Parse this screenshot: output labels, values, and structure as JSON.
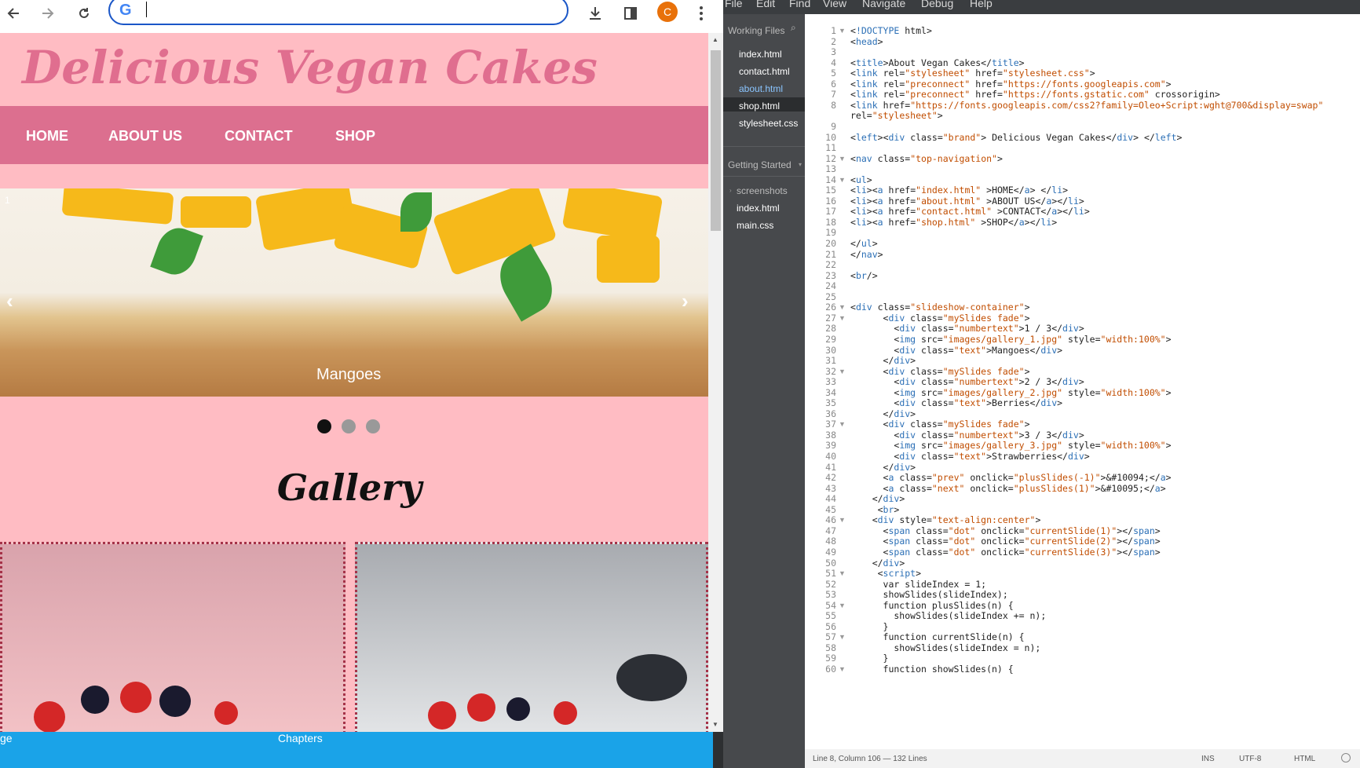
{
  "browser": {
    "google_glyph": "G",
    "profile_initial": "C",
    "icons": [
      "back-arrow-icon",
      "forward-arrow-icon",
      "reload-icon",
      "download-icon",
      "side-panel-icon",
      "more-vert-icon"
    ]
  },
  "site": {
    "brand": "Delicious Vegan Cakes",
    "nav": [
      "HOME",
      "ABOUT US",
      "CONTACT",
      "SHOP"
    ],
    "slide_caption": "Mangoes",
    "prev_arrow": "‹",
    "next_arrow": "›",
    "slide_counter": "1",
    "gallery_title": "Gallery",
    "colors": {
      "background": "#ffbcc3",
      "nav": "#dc6f8f",
      "brand": "#e06e8f"
    }
  },
  "taskbar": {
    "left_fragment": "ge",
    "chapters": "Chapters"
  },
  "editor": {
    "menu": [
      "File",
      "Edit",
      "Find",
      "View",
      "Navigate",
      "Debug",
      "Help"
    ],
    "working_files_label": "Working Files",
    "working_files": [
      "index.html",
      "contact.html",
      "about.html",
      "shop.html",
      "stylesheet.css"
    ],
    "active_file": "about.html",
    "getting_started_label": "Getting Started",
    "project_folder": "screenshots",
    "project_files": [
      "index.html",
      "main.css"
    ],
    "status": {
      "position": "Line 8, Column 106 — 132 Lines",
      "mode": "INS",
      "encoding": "UTF-8",
      "language": "HTML"
    },
    "code_lines": [
      "<!DOCTYPE html>",
      "<head>",
      "",
      "<title>About Vegan Cakes</title>",
      "<link rel=\"stylesheet\" href=\"stylesheet.css\">",
      "<link rel=\"preconnect\" href=\"https://fonts.googleapis.com\">",
      "<link rel=\"preconnect\" href=\"https://fonts.gstatic.com\" crossorigin>",
      "<link href=\"https://fonts.googleapis.com/css2?family=Oleo+Script:wght@700&display=swap\"",
      "rel=\"stylesheet\">",
      "",
      "<left><div class=\"brand\"> Delicious Vegan Cakes</div> </left>",
      "",
      "<nav class=\"top-navigation\">",
      "",
      "<ul>",
      "<li><a href=\"index.html\" >HOME</a> </li>",
      "<li><a href=\"about.html\" >ABOUT US</a></li>",
      "<li><a href=\"contact.html\" >CONTACT</a></li>",
      "<li><a href=\"shop.html\" >SHOP</a></li>",
      "",
      "</ul>",
      "</nav>",
      "",
      "<br/>",
      "",
      "",
      "<div class=\"slideshow-container\">",
      "      <div class=\"mySlides fade\">",
      "        <div class=\"numbertext\">1 / 3</div>",
      "        <img src=\"images/gallery_1.jpg\" style=\"width:100%\">",
      "        <div class=\"text\">Mangoes</div>",
      "      </div>",
      "      <div class=\"mySlides fade\">",
      "        <div class=\"numbertext\">2 / 3</div>",
      "        <img src=\"images/gallery_2.jpg\" style=\"width:100%\">",
      "        <div class=\"text\">Berries</div>",
      "      </div>",
      "      <div class=\"mySlides fade\">",
      "        <div class=\"numbertext\">3 / 3</div>",
      "        <img src=\"images/gallery_3.jpg\" style=\"width:100%\">",
      "        <div class=\"text\">Strawberries</div>",
      "      </div>",
      "      <a class=\"prev\" onclick=\"plusSlides(-1)\">&#10094;</a>",
      "      <a class=\"next\" onclick=\"plusSlides(1)\">&#10095;</a>",
      "    </div>",
      "     <br>",
      "    <div style=\"text-align:center\">",
      "      <span class=\"dot\" onclick=\"currentSlide(1)\"></span>",
      "      <span class=\"dot\" onclick=\"currentSlide(2)\"></span>",
      "      <span class=\"dot\" onclick=\"currentSlide(3)\"></span>",
      "    </div>",
      "     <script>",
      "      var slideIndex = 1;",
      "      showSlides(slideIndex);",
      "      function plusSlides(n) {",
      "        showSlides(slideIndex += n);",
      "      }",
      "      function currentSlide(n) {",
      "        showSlides(slideIndex = n);",
      "      }",
      "      function showSlides(n) {"
    ],
    "line_numbers": [
      "1",
      "2",
      "3",
      "4",
      "5",
      "6",
      "7",
      "8",
      "",
      "9",
      "10",
      "11",
      "12",
      "13",
      "14",
      "15",
      "16",
      "17",
      "18",
      "19",
      "20",
      "21",
      "22",
      "23",
      "24",
      "25",
      "26",
      "27",
      "28",
      "29",
      "30",
      "31",
      "32",
      "33",
      "34",
      "35",
      "36",
      "37",
      "38",
      "39",
      "40",
      "41",
      "42",
      "43",
      "44",
      "45",
      "46",
      "47",
      "48",
      "49",
      "50",
      "51",
      "52",
      "53",
      "54",
      "55",
      "56",
      "57",
      "58",
      "59",
      "60"
    ]
  }
}
